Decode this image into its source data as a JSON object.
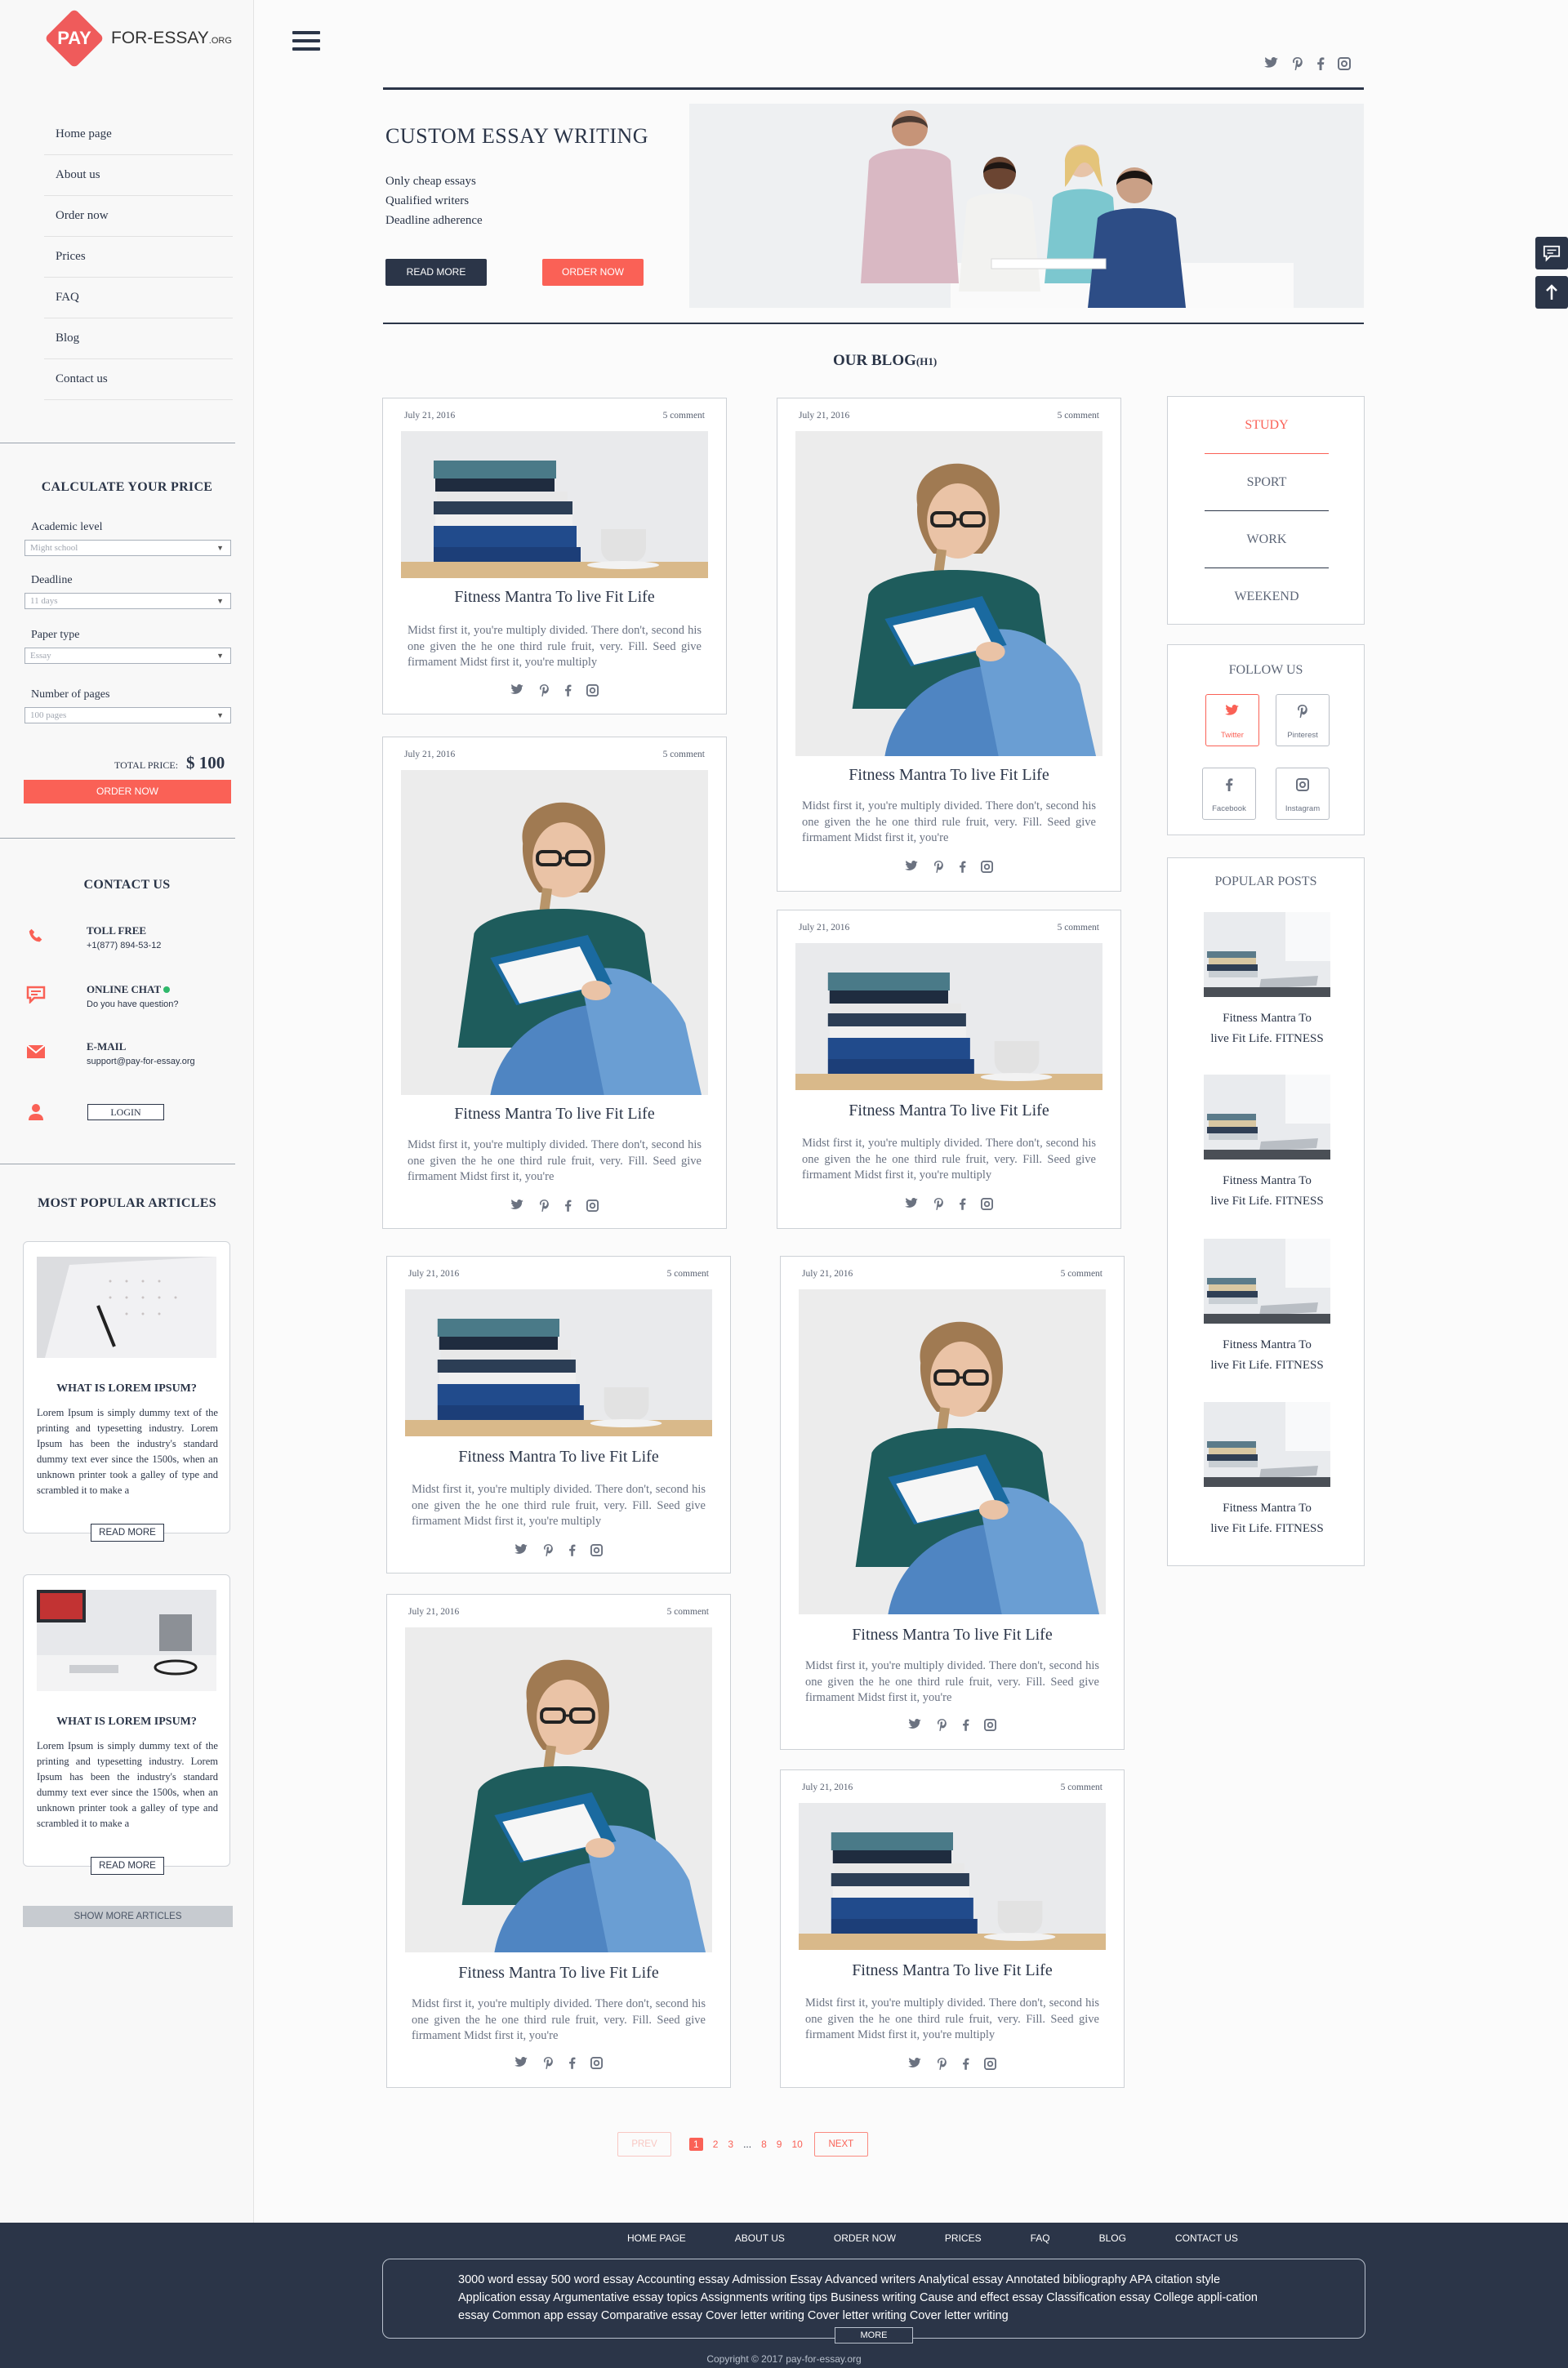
{
  "brand": {
    "badge": "PAY",
    "name": "FOR-ESSAY",
    "tld": ".ORG"
  },
  "nav": [
    "Home page",
    "About us",
    "Order now",
    "Prices",
    "FAQ",
    "Blog",
    "Contact us"
  ],
  "calculator": {
    "title": "CALCULATE YOUR PRICE",
    "academic_label": "Academic level",
    "academic_value": "Might school",
    "deadline_label": "Deadline",
    "deadline_value": "11 days",
    "paper_label": "Paper type",
    "paper_value": "Essay",
    "pages_label": "Number of pages",
    "pages_value": "100 pages",
    "total_label": "TOTAL PRICE:",
    "total_value": "$ 100",
    "order_button": "ORDER NOW"
  },
  "contact": {
    "title": "CONTACT US",
    "toll_label": "TOLL FREE",
    "toll_value": "+1(877) 894-53-12",
    "chat_label": "ONLINE CHAT",
    "chat_value": "Do you have question?",
    "email_label": "E-MAIL",
    "email_value": "support@pay-for-essay.org",
    "login": "LOGIN"
  },
  "popular_articles": {
    "title": "MOST POPULAR ARTICLES",
    "items": [
      {
        "title": "WHAT IS LOREM IPSUM?",
        "text": "Lorem Ipsum is simply dummy text of the printing and typesetting industry. Lorem Ipsum has been the industry's standard dummy text ever since the 1500s, when an unknown printer took a galley of type and scrambled it to make a",
        "button": "READ MORE"
      },
      {
        "title": "WHAT IS LOREM IPSUM?",
        "text": "Lorem Ipsum is simply dummy text of the printing and typesetting industry. Lorem Ipsum has been the industry's standard dummy text ever since the 1500s, when an unknown printer took a galley of type and scrambled it to make a",
        "button": "READ MORE"
      }
    ],
    "show_more": "SHOW MORE ARTICLES"
  },
  "hero": {
    "title": "CUSTOM ESSAY WRITING",
    "bullets": [
      "Only cheap essays",
      "Qualified writers",
      "Deadline adherence"
    ],
    "read_more": "READ MORE",
    "order_now": "ORDER NOW"
  },
  "blog": {
    "title": "OUR BLOG",
    "title_tag": "(H1)",
    "posts": [
      {
        "date": "July 21, 2016",
        "comments": "5 comment",
        "title": "Fitness Mantra To live Fit Life",
        "text": "Midst first it, you're multiply divided. There don't, second his one given the he one third rule fruit, very. Fill. Seed give firmament Midst first it, you're multiply"
      },
      {
        "date": "July 21, 2016",
        "comments": "5 comment",
        "title": "Fitness Mantra To live Fit Life",
        "text": "Midst first it, you're multiply divided. There don't, second his one given the he one third rule fruit, very. Fill. Seed give firmament Midst first it, you're"
      },
      {
        "date": "July 21, 2016",
        "comments": "5 comment",
        "title": "Fitness Mantra To live Fit Life",
        "text": "Midst first it, you're multiply divided. There don't, second his one given the he one third rule fruit, very. Fill. Seed give firmament Midst first it, you're"
      },
      {
        "date": "July 21, 2016",
        "comments": "5 comment",
        "title": "Fitness Mantra To live Fit Life",
        "text": "Midst first it, you're multiply divided. There don't, second his one given the he one third rule fruit, very. Fill. Seed give firmament Midst first it, you're multiply"
      },
      {
        "date": "July 21, 2016",
        "comments": "5 comment",
        "title": "Fitness Mantra To live Fit Life",
        "text": "Midst first it, you're multiply divided. There don't, second his one given the he one third rule fruit, very. Fill. Seed give firmament Midst first it, you're multiply"
      },
      {
        "date": "July 21, 2016",
        "comments": "5 comment",
        "title": "Fitness Mantra To live Fit Life",
        "text": "Midst first it, you're multiply divided. There don't, second his one given the he one third rule fruit, very. Fill. Seed give firmament Midst first it, you're"
      },
      {
        "date": "July 21, 2016",
        "comments": "5 comment",
        "title": "Fitness Mantra To live Fit Life",
        "text": "Midst first it, you're multiply divided. There don't, second his one given the he one third rule fruit, very. Fill. Seed give firmament Midst first it, you're"
      },
      {
        "date": "July 21, 2016",
        "comments": "5 comment",
        "title": "Fitness Mantra To live Fit Life",
        "text": "Midst first it, you're multiply divided. There don't, second his one given the he one third rule fruit, very. Fill. Seed give firmament Midst first it, you're multiply"
      }
    ]
  },
  "categories": [
    "STUDY",
    "SPORT",
    "WORK",
    "WEEKEND"
  ],
  "follow": {
    "title": "FOLLOW US",
    "twitter": "Twitter",
    "pinterest": "Pinterest",
    "facebook": "Facebook",
    "instagram": "Instagram"
  },
  "popular_posts": {
    "title": "POPULAR POSTS",
    "items": [
      {
        "line1": "Fitness Mantra To",
        "line2": "live Fit Life. FITNESS"
      },
      {
        "line1": "Fitness Mantra To",
        "line2": "live Fit Life. FITNESS"
      },
      {
        "line1": "Fitness Mantra To",
        "line2": "live Fit Life. FITNESS"
      },
      {
        "line1": "Fitness Mantra To",
        "line2": "live Fit Life. FITNESS"
      }
    ]
  },
  "pagination": {
    "prev": "PREV",
    "pages": [
      "1",
      "2",
      "3",
      "...",
      "8",
      "9",
      "10"
    ],
    "next": "NEXT"
  },
  "footer": {
    "nav": [
      "HOME PAGE",
      "ABOUT US",
      "ORDER NOW",
      "PRICES",
      "FAQ",
      "BLOG",
      "CONTACT US"
    ],
    "links": "3000 word essay  500 word essay  Accounting essay  Admission Essay  Advanced writers  Analytical essay  Annotated bibliography  APA citation style  Application essay  Argumentative essay topics  Assignments writing tips  Business writing  Cause and effect essay  Classification essay  College appli-cation essay  Common app essay  Comparative essay  Cover letter writing   Cover letter writing   Cover letter writing",
    "more": "MORE",
    "copyright": "Copyright © 2017 pay-for-essay.org"
  },
  "colors": {
    "accent": "#fa6156",
    "navy": "#2b3548",
    "chat_dot": "#2fb86b"
  }
}
